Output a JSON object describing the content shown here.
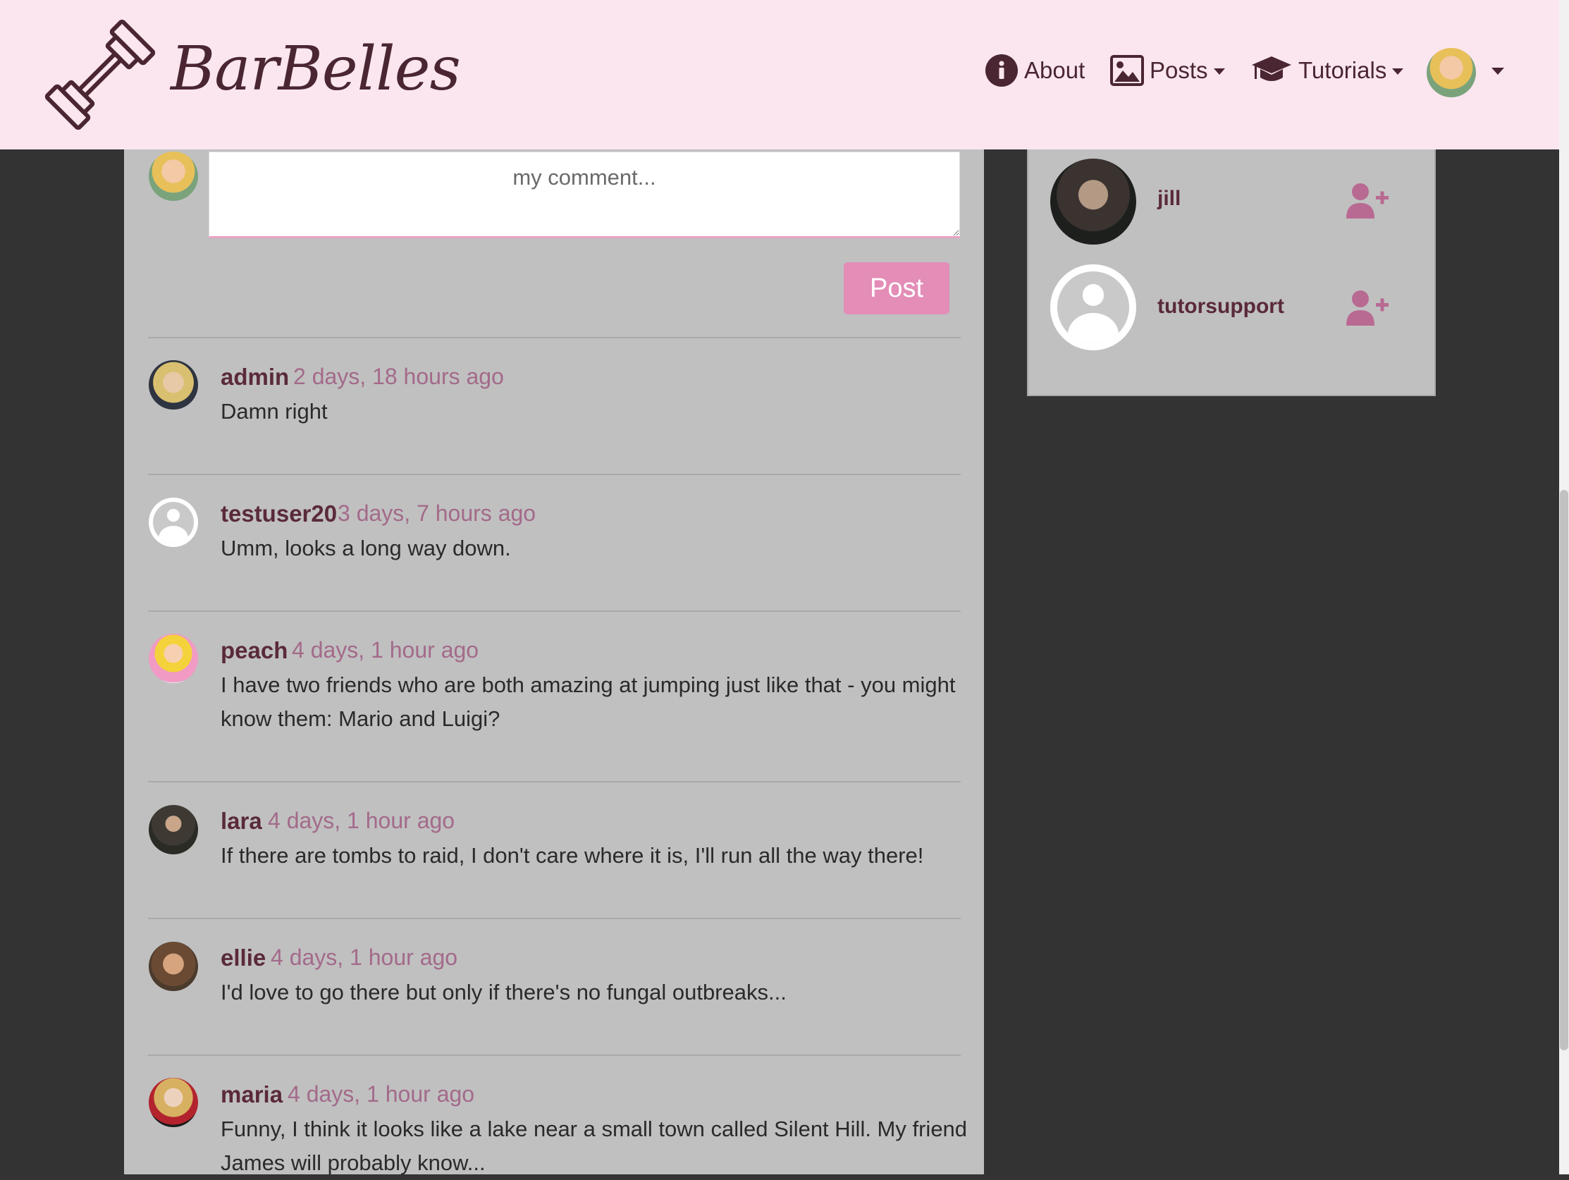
{
  "brand": {
    "name": "BarBelles",
    "icon": "barbell-icon"
  },
  "nav": {
    "about": {
      "label": "About",
      "icon": "info-circle-icon"
    },
    "posts": {
      "label": "Posts",
      "icon": "image-icon"
    },
    "tutorials": {
      "label": "Tutorials",
      "icon": "graduation-cap-icon"
    }
  },
  "comment_form": {
    "placeholder": "my comment...",
    "post_label": "Post"
  },
  "comments": [
    {
      "author": "admin",
      "time": "2 days, 18 hours ago",
      "text": "Damn right"
    },
    {
      "author": "testuser20",
      "time": "3 days, 7 hours ago",
      "text": "Umm, looks a long way down."
    },
    {
      "author": "peach",
      "time": "4 days, 1 hour ago",
      "text": "I have two friends who are both amazing at jumping just like that - you might know them: Mario and Luigi?"
    },
    {
      "author": "lara",
      "time": "4 days, 1 hour ago",
      "text": "If there are tombs to raid, I don't care where it is, I'll run all the way there!"
    },
    {
      "author": "ellie",
      "time": "4 days, 1 hour ago",
      "text": "I'd love to go there but only if there's no fungal outbreaks..."
    },
    {
      "author": "maria",
      "time": "4 days, 1 hour ago",
      "text": "Funny, I think it looks like a lake near a small town called Silent Hill. My friend James will probably know..."
    }
  ],
  "suggested_users": [
    {
      "name": "jill",
      "action_icon": "user-plus-icon"
    },
    {
      "name": "tutorsupport",
      "action_icon": "user-plus-icon"
    }
  ],
  "colors": {
    "navbar_bg": "#fbe6ef",
    "accent": "#e38db7",
    "panel_bg": "#c0c0c0",
    "page_bg": "#333333",
    "author_text": "#5a2a3a",
    "timestamp_text": "#a36a8a"
  }
}
